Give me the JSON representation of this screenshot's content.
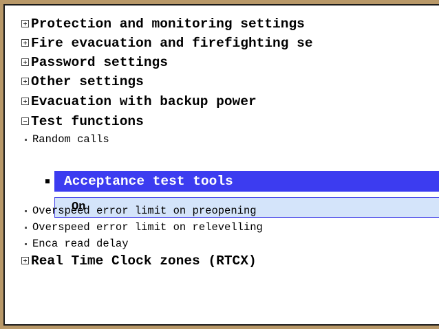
{
  "tree": {
    "groups_top": [
      {
        "label": "Protection and monitoring settings",
        "state": "collapsed"
      },
      {
        "label": "Fire evacuation and firefighting se",
        "state": "collapsed"
      },
      {
        "label": "Password settings",
        "state": "collapsed"
      },
      {
        "label": "Other settings",
        "state": "collapsed"
      },
      {
        "label": "Evacuation with backup power",
        "state": "collapsed"
      },
      {
        "label": "Test functions",
        "state": "expanded"
      }
    ],
    "test_function_items": {
      "random_calls": "Random calls",
      "selected": {
        "label": "Acceptance test tools",
        "value": "On"
      },
      "overspeed_preopening": "Overspeed error limit on preopening",
      "overspeed_relevelling": "Overspeed error limit on relevelling",
      "enca_read_delay": "Enca read delay"
    },
    "groups_bottom": [
      {
        "label": "Real Time Clock zones (RTCX)",
        "state": "collapsed"
      }
    ]
  },
  "colors": {
    "frame_outer": "#b89868",
    "selection_header": "#3c3cf0",
    "selection_value_bg": "#d4e4fa"
  },
  "icons": {
    "collapsed": "plus-box-icon",
    "expanded": "minus-box-icon",
    "item": "bullet-icon"
  }
}
